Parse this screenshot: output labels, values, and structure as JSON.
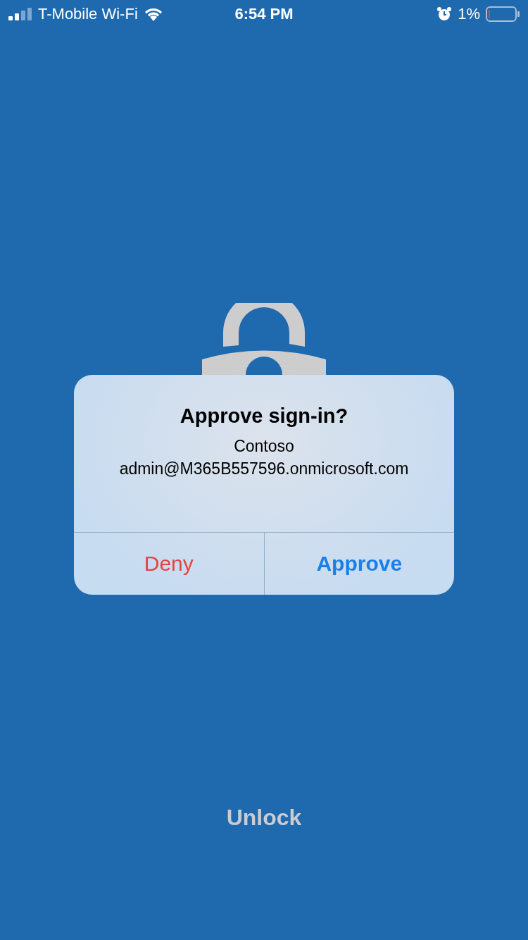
{
  "status_bar": {
    "carrier": "T-Mobile Wi-Fi",
    "time": "6:54 PM",
    "battery": "1%"
  },
  "dialog": {
    "title": "Approve sign-in?",
    "organization": "Contoso",
    "account": "admin@M365B557596.onmicrosoft.com",
    "actions": [
      {
        "label": "Deny",
        "kind": "destructive"
      },
      {
        "label": "Approve",
        "kind": "preferred"
      }
    ]
  },
  "unlock_label": "Unlock"
}
